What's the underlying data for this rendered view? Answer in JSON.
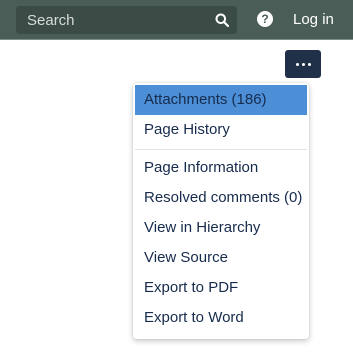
{
  "header": {
    "search": {
      "placeholder": "Search",
      "value": "",
      "icon": "search-icon"
    },
    "help_icon": "question-circle-icon",
    "help_glyph": "?",
    "login_label": "Log in"
  },
  "more_actions": {
    "icon": "ellipsis-icon"
  },
  "menu": {
    "group1": [
      {
        "label": "Attachments (186)",
        "active": true
      },
      {
        "label": "Page History"
      }
    ],
    "group2": [
      {
        "label": "Page Information"
      },
      {
        "label": "Resolved comments (0)"
      },
      {
        "label": "View in Hierarchy"
      },
      {
        "label": "View Source"
      },
      {
        "label": "Export to PDF"
      },
      {
        "label": "Export to Word"
      }
    ]
  },
  "colors": {
    "header_bg": "#4a5d56",
    "search_bg": "#3b4c46",
    "more_button_bg": "#1f3048",
    "menu_highlight": "#4c8fd6",
    "menu_text": "#172b4d"
  }
}
